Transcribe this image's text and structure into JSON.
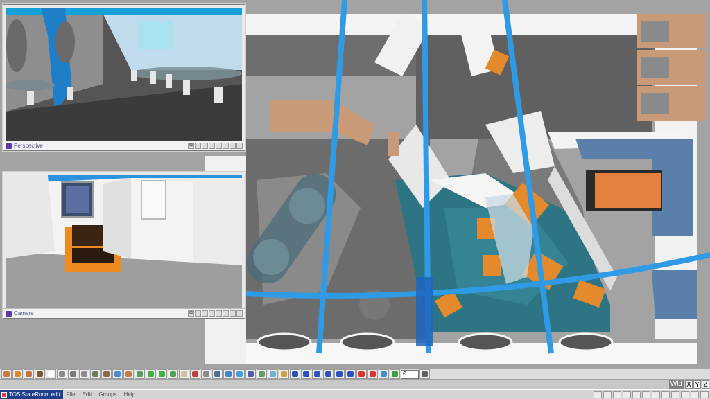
{
  "app": {
    "title": "TOS StateRoom edit"
  },
  "menu": [
    "File",
    "Edit",
    "Groups",
    "Help"
  ],
  "viewports": {
    "perspective": {
      "label": "Perspective",
      "close": "⊠"
    },
    "camera": {
      "label": "Camera",
      "close": "⊠"
    }
  },
  "toolbar": {
    "frame_value": "0",
    "tool_icons": [
      "box-icon",
      "cube-icon",
      "sphere-icon",
      "chair-icon",
      "cursor-icon",
      "move-icon",
      "rotate-icon",
      "scale-icon",
      "mesh-icon",
      "terrain-icon",
      "water-icon",
      "fence-icon",
      "path-icon",
      "wave-icon",
      "light-icon",
      "tube-icon",
      "bone-icon",
      "paint-icon",
      "grid-icon",
      "texture-icon",
      "camera-icon",
      "sky-icon",
      "hatch-icon",
      "rings-icon",
      "layers-icon",
      "shape-icon",
      "rewind-icon",
      "step-back-icon",
      "play-back-icon",
      "play-icon",
      "step-forward-icon",
      "fast-forward-icon",
      "record-icon",
      "record-alt-icon",
      "swap-icon",
      "loop-icon",
      "keyframe-icon"
    ],
    "tool_colors": [
      "#c77b3a",
      "#d98b2c",
      "#c5773d",
      "#7a5a3a",
      "#ffffff",
      "#8a8a8a",
      "#7a7a7a",
      "#8c8c8c",
      "#6a7a5a",
      "#8a6a4a",
      "#4a8ad0",
      "#c87b4a",
      "#5a9a5a",
      "#40b040",
      "#40b040",
      "#50a050",
      "#d0c0a0",
      "#c04040",
      "#8a8a8a",
      "#507090",
      "#4080d0",
      "#40a0e0",
      "#5060b0",
      "#60a060",
      "#70b0d0",
      "#d0a040",
      "#3050c0",
      "#3050c0",
      "#3050c0",
      "#3050c0",
      "#3050c0",
      "#3050c0",
      "#e03030",
      "#e03030",
      "#4090d0",
      "#40a040",
      "#606060"
    ]
  },
  "axis": {
    "label": "Wld",
    "buttons": [
      "X",
      "Y",
      "Z"
    ]
  }
}
